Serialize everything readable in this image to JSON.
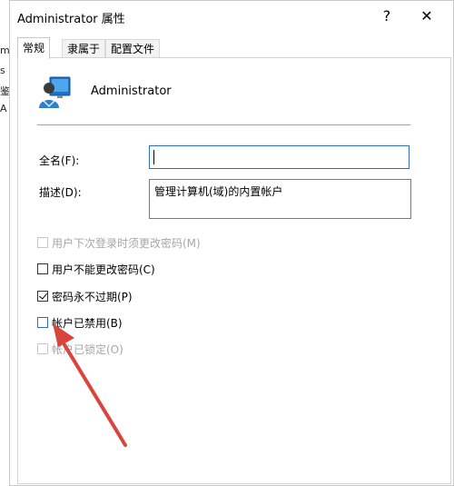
{
  "window": {
    "title": "Administrator 属性",
    "minimize_glyph": "?",
    "close_glyph": "✕"
  },
  "tabs": [
    {
      "label": "常规",
      "active": true
    },
    {
      "label": "隶属于",
      "active": false
    },
    {
      "label": "配置文件",
      "active": false
    }
  ],
  "user": {
    "name": "Administrator",
    "icon": "user-avatar-icon"
  },
  "fields": {
    "fullname_label": "全名(F):",
    "fullname_value": "",
    "description_label": "描述(D):",
    "description_value": "管理计算机(域)的内置帐户"
  },
  "options": [
    {
      "label": "用户下次登录时须更改密码(M)",
      "checked": false,
      "disabled": true
    },
    {
      "label": "用户不能更改密码(C)",
      "checked": false,
      "disabled": false
    },
    {
      "label": "密码永不过期(P)",
      "checked": true,
      "disabled": false
    },
    {
      "label": "帐户已禁用(B)",
      "checked": false,
      "disabled": false
    },
    {
      "label": "帐户已锁定(O)",
      "checked": false,
      "disabled": true
    }
  ],
  "background_chars": [
    "m",
    "s",
    "鉴",
    "A"
  ],
  "colors": {
    "annotation_arrow": "#d9443c",
    "focus_border": "#2a6fd0",
    "disabled_text": "#a6a6a6"
  }
}
